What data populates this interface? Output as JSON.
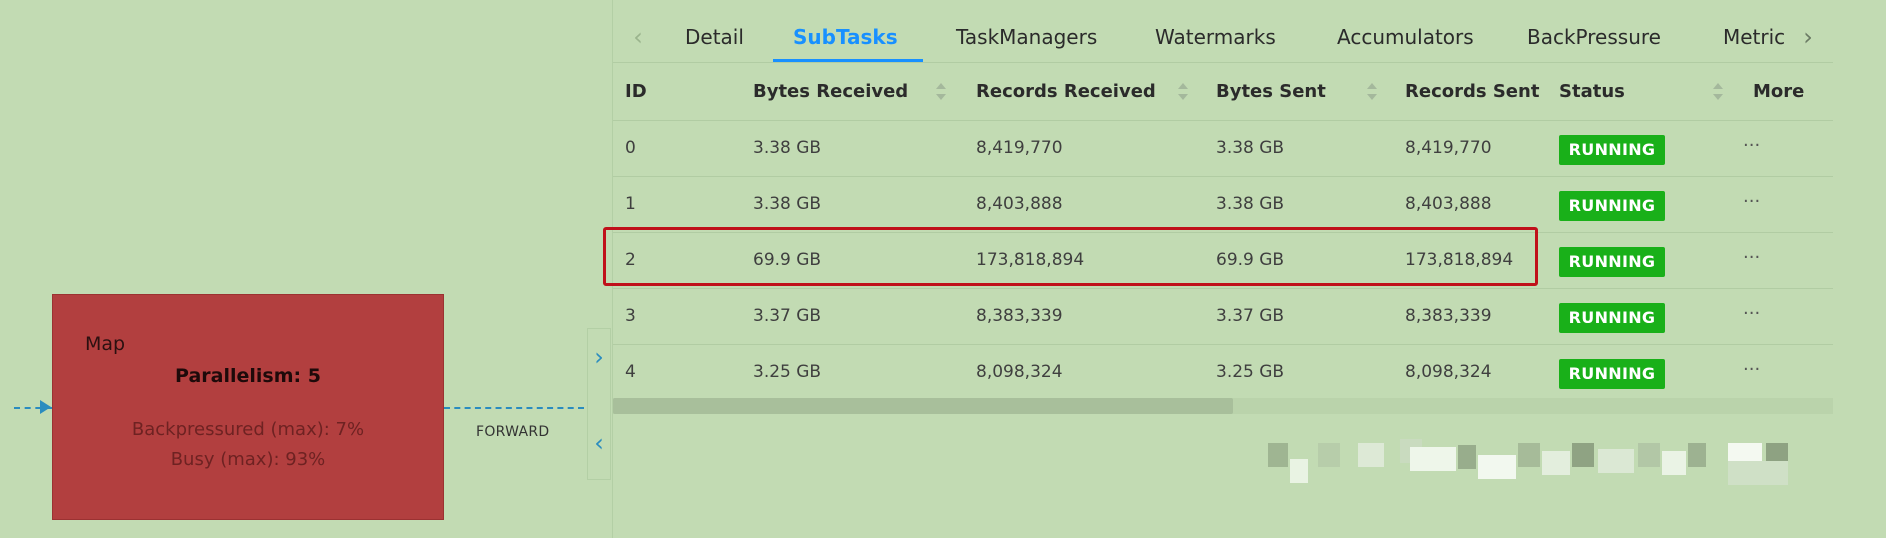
{
  "graph": {
    "node": {
      "title": "Map",
      "parallelism": "Parallelism: 5",
      "backpressured": "Backpressured (max): 7%",
      "busy": "Busy (max): 93%",
      "fill_color": "#b23f3f"
    },
    "edge_label": "FORWARD",
    "edge_color": "#2a8cbf"
  },
  "panel": {
    "tabs": [
      {
        "label": "Detail"
      },
      {
        "label": "SubTasks",
        "active": true
      },
      {
        "label": "TaskManagers"
      },
      {
        "label": "Watermarks"
      },
      {
        "label": "Accumulators"
      },
      {
        "label": "BackPressure"
      },
      {
        "label": "Metric"
      }
    ],
    "accent_color": "#1890ff",
    "columns": [
      "ID",
      "Bytes Received",
      "Records Received",
      "Bytes Sent",
      "Records Sent",
      "Status",
      "More"
    ],
    "rows": [
      {
        "id": "0",
        "bytes_received": "3.38 GB",
        "records_received": "8,419,770",
        "bytes_sent": "3.38 GB",
        "records_sent": "8,419,770",
        "status": "RUNNING",
        "more": "···"
      },
      {
        "id": "1",
        "bytes_received": "3.38 GB",
        "records_received": "8,403,888",
        "bytes_sent": "3.38 GB",
        "records_sent": "8,403,888",
        "status": "RUNNING",
        "more": "···"
      },
      {
        "id": "2",
        "bytes_received": "69.9 GB",
        "records_received": "173,818,894",
        "bytes_sent": "69.9 GB",
        "records_sent": "173,818,894",
        "status": "RUNNING",
        "more": "···"
      },
      {
        "id": "3",
        "bytes_received": "3.37 GB",
        "records_received": "8,383,339",
        "bytes_sent": "3.37 GB",
        "records_sent": "8,383,339",
        "status": "RUNNING",
        "more": "···"
      },
      {
        "id": "4",
        "bytes_received": "3.25 GB",
        "records_received": "8,098,324",
        "bytes_sent": "3.25 GB",
        "records_sent": "8,098,324",
        "status": "RUNNING",
        "more": "···"
      }
    ],
    "highlighted_row_id": "2",
    "highlight_color": "#c0101a",
    "status_color": "#19b019"
  },
  "icons": {
    "tab_prev": "‹",
    "tab_next": "›",
    "expand": "›",
    "collapse": "‹"
  }
}
